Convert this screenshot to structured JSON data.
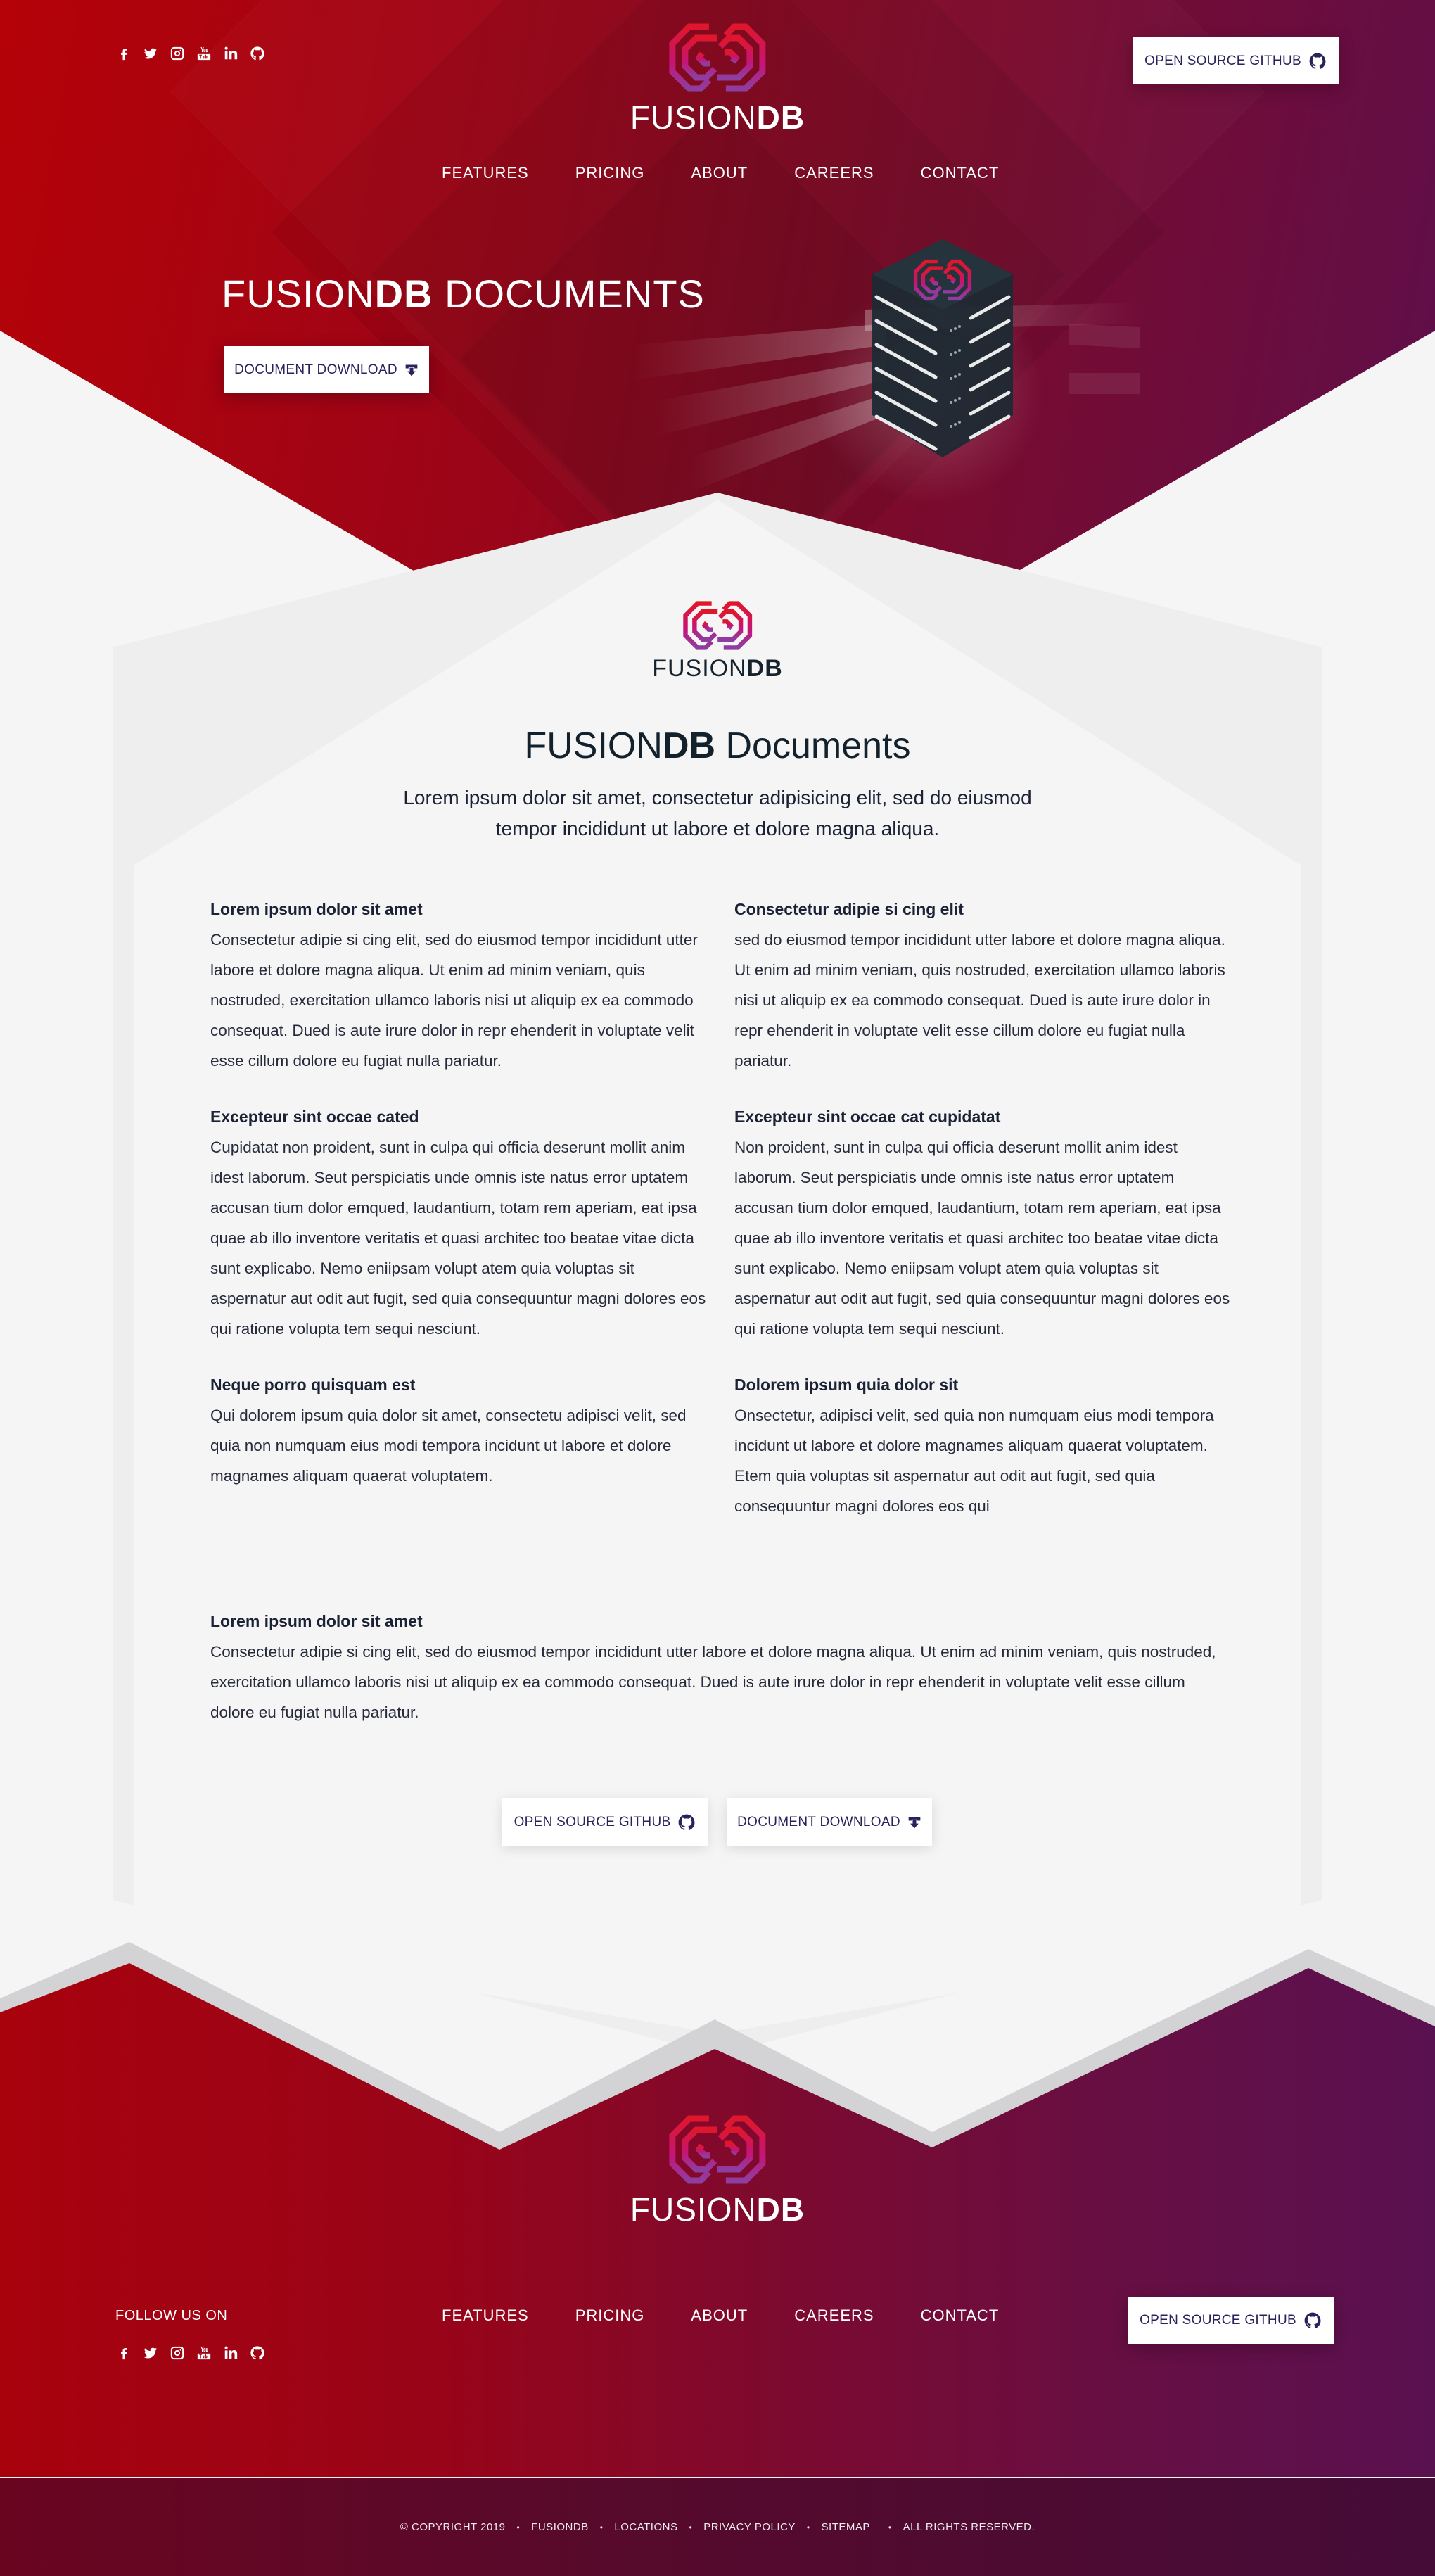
{
  "brand": {
    "name_light": "FUSION",
    "name_bold": "DB",
    "colors": {
      "hero_red": "#b50208",
      "hero_purple": "#5e0f4b",
      "button_text": "#27235c",
      "body_text": "#1c2236",
      "panel_bg": "#f5f5f6",
      "logo_gradient_top": "#e0162b",
      "logo_gradient_bottom": "#8e3ea0"
    }
  },
  "header": {
    "social_icons": [
      "facebook-icon",
      "twitter-icon",
      "instagram-icon",
      "youtube-icon",
      "linkedin-icon",
      "github-icon"
    ],
    "nav": [
      "FEATURES",
      "PRICING",
      "ABOUT",
      "CAREERS",
      "CONTACT"
    ],
    "github_button": {
      "label": "OPEN SOURCE GITHUB",
      "icon": "github-icon"
    }
  },
  "hero": {
    "title_light": "FUSION",
    "title_bold": "DB",
    "title_rest": " DOCUMENTS",
    "download_button": {
      "label": "DOCUMENT DOWNLOAD",
      "icon": "download-icon"
    }
  },
  "main": {
    "title_light": "FUSION",
    "title_bold": "DB",
    "title_rest": " Documents",
    "intro": "Lorem ipsum dolor sit amet, consectetur adipisicing elit, sed do eiusmod tempor incididunt ut labore et dolore magna aliqua.",
    "left_sections": [
      {
        "heading": "Lorem ipsum dolor sit amet",
        "body": "Consectetur adipie si cing elit, sed do eiusmod tempor incididunt utter labore et dolore magna aliqua. Ut enim ad minim veniam, quis nostruded, exercitation ullamco laboris nisi ut aliquip ex ea commodo consequat. Dued is aute irure dolor in repr ehenderit in voluptate velit esse cillum dolore eu fugiat nulla pariatur."
      },
      {
        "heading": "Excepteur sint occae cated",
        "body": "Cupidatat non proident, sunt in culpa qui officia deserunt mollit anim idest laborum. Seut perspiciatis unde omnis iste natus error uptatem accusan tium dolor emqued, laudantium, totam rem aperiam, eat ipsa quae ab illo inventore veritatis et quasi architec too beatae vitae dicta sunt explicabo. Nemo eniipsam volupt atem quia voluptas sit aspernatur aut odit aut fugit, sed quia consequuntur magni dolores eos qui ratione volupta tem sequi nesciunt."
      },
      {
        "heading": "Neque porro quisquam est",
        "body": "Qui dolorem ipsum quia dolor sit amet, consectetu adipisci velit, sed quia non numquam eius modi tempora incidunt ut labore et dolore magnames aliquam quaerat voluptatem."
      }
    ],
    "right_sections": [
      {
        "heading": "Consectetur adipie si cing elit",
        "body": "sed do eiusmod tempor incididunt utter labore et dolore magna aliqua. Ut enim ad minim veniam, quis nostruded, exercitation ullamco laboris nisi ut aliquip ex ea commodo consequat. Dued is aute irure dolor in repr ehenderit in voluptate velit esse cillum dolore eu fugiat nulla pariatur."
      },
      {
        "heading": "Excepteur sint occae cat cupidatat",
        "body": "Non proident, sunt in culpa qui officia deserunt mollit anim idest laborum. Seut perspiciatis unde omnis iste natus error uptatem accusan tium dolor emqued, laudantium, totam rem aperiam, eat ipsa quae ab illo inventore veritatis et quasi architec too beatae vitae dicta sunt explicabo. Nemo eniipsam volupt atem quia voluptas sit aspernatur aut odit aut fugit, sed quia consequuntur magni dolores eos qui ratione volupta tem sequi nesciunt."
      },
      {
        "heading": "Dolorem ipsum quia dolor sit",
        "body": "Onsectetur, adipisci velit, sed quia non numquam eius modi tempora incidunt ut labore et dolore magnames aliquam quaerat voluptatem. Etem quia voluptas sit aspernatur aut odit aut fugit, sed quia consequuntur magni dolores eos qui"
      }
    ],
    "full_section": {
      "heading": "Lorem ipsum dolor sit amet",
      "body": "Consectetur adipie si cing elit, sed do eiusmod tempor incididunt utter labore et dolore magna aliqua. Ut enim ad minim veniam, quis nostruded, exercitation ullamco laboris nisi ut aliquip ex ea commodo consequat. Dued is aute irure dolor in repr ehenderit in voluptate velit esse cillum dolore eu fugiat nulla pariatur."
    },
    "github_button": {
      "label": "OPEN SOURCE GITHUB",
      "icon": "github-icon"
    },
    "download_button": {
      "label": "DOCUMENT DOWNLOAD",
      "icon": "download-icon"
    }
  },
  "footer": {
    "follow_label": "FOLLOW US ON",
    "social_icons": [
      "facebook-icon",
      "twitter-icon",
      "instagram-icon",
      "youtube-icon",
      "linkedin-icon",
      "github-icon"
    ],
    "nav": [
      "FEATURES",
      "PRICING",
      "ABOUT",
      "CAREERS",
      "CONTACT"
    ],
    "github_button": {
      "label": "OPEN SOURCE GITHUB",
      "icon": "github-icon"
    },
    "legal": [
      "© COPYRIGHT 2019",
      "FUSIONDB",
      "LOCATIONS",
      "PRIVACY POLICY",
      "SITEMAP",
      "ALL RIGHTS RESERVED."
    ]
  }
}
